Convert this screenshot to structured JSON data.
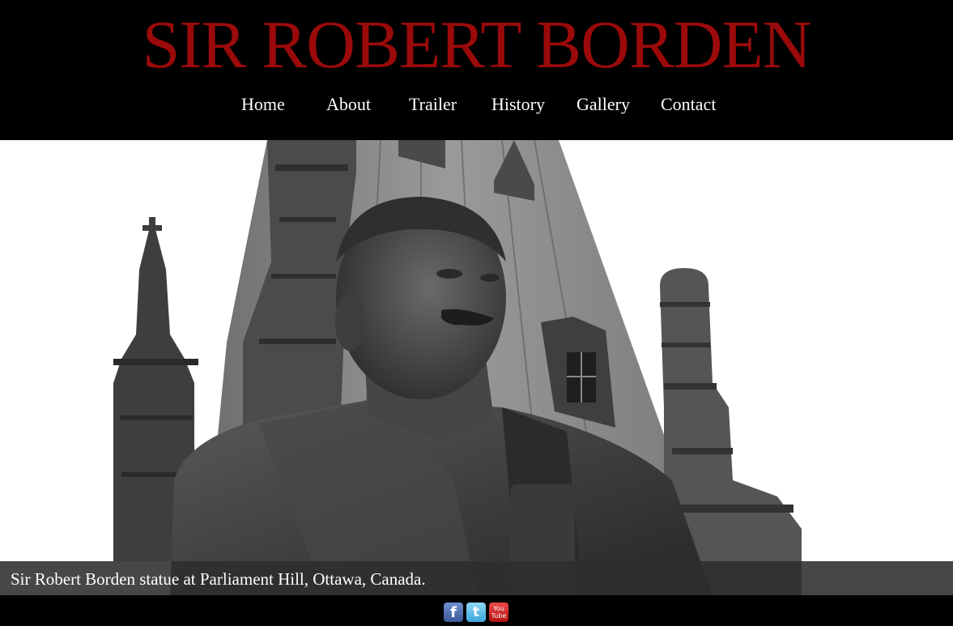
{
  "site": {
    "title": "SIR ROBERT BORDEN"
  },
  "nav": {
    "items": [
      {
        "label": "Home"
      },
      {
        "label": "About"
      },
      {
        "label": "Trailer"
      },
      {
        "label": "History"
      },
      {
        "label": "Gallery"
      },
      {
        "label": "Contact"
      }
    ]
  },
  "hero": {
    "image": "statue-photo",
    "caption": "Sir Robert Borden statue at Parliament Hill, Ottawa, Canada."
  },
  "footer": {
    "social": [
      {
        "icon": "facebook-icon",
        "glyph": "f"
      },
      {
        "icon": "twitter-icon",
        "glyph": "t"
      },
      {
        "icon": "youtube-icon",
        "glyph_top": "You",
        "glyph_bottom": "Tube"
      }
    ]
  },
  "colors": {
    "title": "#9b0a0a",
    "background": "#000000",
    "nav_text": "#ffffff"
  }
}
